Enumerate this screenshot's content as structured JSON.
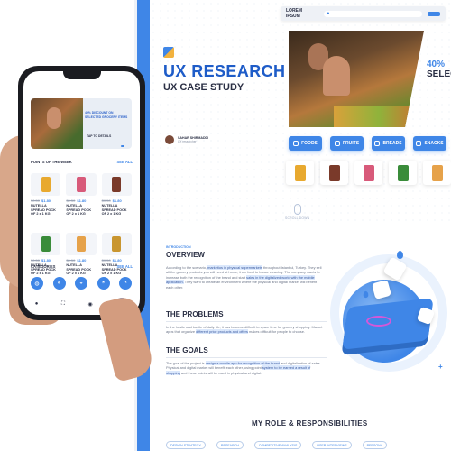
{
  "header": {
    "brand": "LOREM IPSUM"
  },
  "case": {
    "title": "UX RESEARCH",
    "subtitle": "UX CASE STUDY",
    "author_name": "SAHAR SHIRMADDI",
    "author_role": "UX researcher"
  },
  "hero": {
    "discount": "40%",
    "discount_word": "SELEC"
  },
  "categories": [
    {
      "label": "FOODS"
    },
    {
      "label": "FRUITS"
    },
    {
      "label": "BREADS"
    },
    {
      "label": "SNACKS"
    }
  ],
  "scroll_label": "SCROLL DOWN",
  "phone": {
    "promo": "40% DISCOUNT ON SELECTED GROCERY ITEMS",
    "promo_detail": "TAP TO DETAILS",
    "section_points": "POINTS OF THE WEEK",
    "see_all_1": "SEE ALL",
    "section_categories": "CATEGORIES",
    "see_all_2": "SEE ALL",
    "products": [
      {
        "old": "$0.50",
        "new": "$1.80",
        "name": "NUTELLA SPREAD POCK OF 2 x 1 KG",
        "color": "#e8a92f"
      },
      {
        "old": "$0.50",
        "new": "$1.80",
        "name": "NUTELLA SPREAD POCK OF 2 x 1 KG",
        "color": "#d85a7a"
      },
      {
        "old": "$0.50",
        "new": "$1.80",
        "name": "NUTELLA SPREAD POCK OF 2 x 1 KG",
        "color": "#7a3a2a"
      },
      {
        "old": "$0.50",
        "new": "$1.80",
        "name": "NUTELLA SPREAD POCK OF 2 x 1 KG",
        "color": "#3a8c3a"
      },
      {
        "old": "$0.50",
        "new": "$1.80",
        "name": "NUTELLA SPREAD POCK OF 2 x 1 KG",
        "color": "#e6a24a"
      },
      {
        "old": "$0.50",
        "new": "$1.80",
        "name": "NUTELLA SPREAD POCK OF 2 x 1 KG",
        "color": "#c99630"
      }
    ]
  },
  "overview": {
    "label": "INTRODUCTION",
    "title": "OVERVIEW",
    "text_before": "According to the scenario, ",
    "text_hl1": "marketios in physical supermarkets",
    "text_mid": " throughout Istanbul, Turkey. They sell all the grocery products you will need at home, from food to house cleaning. The company wants to increase both the recognition of the brand and start ",
    "text_hl2": "sales in the digitalized world with the mobile application.",
    "text_after": " They want to create an environment where the physical and digital market will benefit each other."
  },
  "problems": {
    "title": "THE PROBLEMS",
    "text_before": "In the hustle and bustle of daily life, it has become difficult to spare time for grocery shopping. Market apps that organize ",
    "text_hl": "different price products and offers",
    "text_after": " makes difficult for people to choose."
  },
  "goals": {
    "title": "THE GOALS",
    "text_before": "The goal of the project is ",
    "text_hl1": "design a mobile app for recognition of the brand",
    "text_mid": " and digitalization of sales. Physical and digital market will benefit each other, using point ",
    "text_hl2": "system to be earned a result of shopping",
    "text_after": " and these points will be used in physical and digital."
  },
  "roles": {
    "title": "MY ROLE & RESPONSIBILITIES",
    "items": [
      "DESIGN STRATEGY",
      "RESEARCH",
      "COMPETITIVE ANALYSIS",
      "USER INTERVIEWS",
      "PERSONA"
    ]
  },
  "colors": {
    "accent": "#3f86e7",
    "title_blue": "#1e5cc8",
    "text_dark": "#2a2f44"
  },
  "icons": [
    "search-icon",
    "home-icon",
    "cart-icon",
    "user-icon",
    "bag-icon",
    "fruit-icon",
    "bread-icon",
    "snack-icon"
  ]
}
